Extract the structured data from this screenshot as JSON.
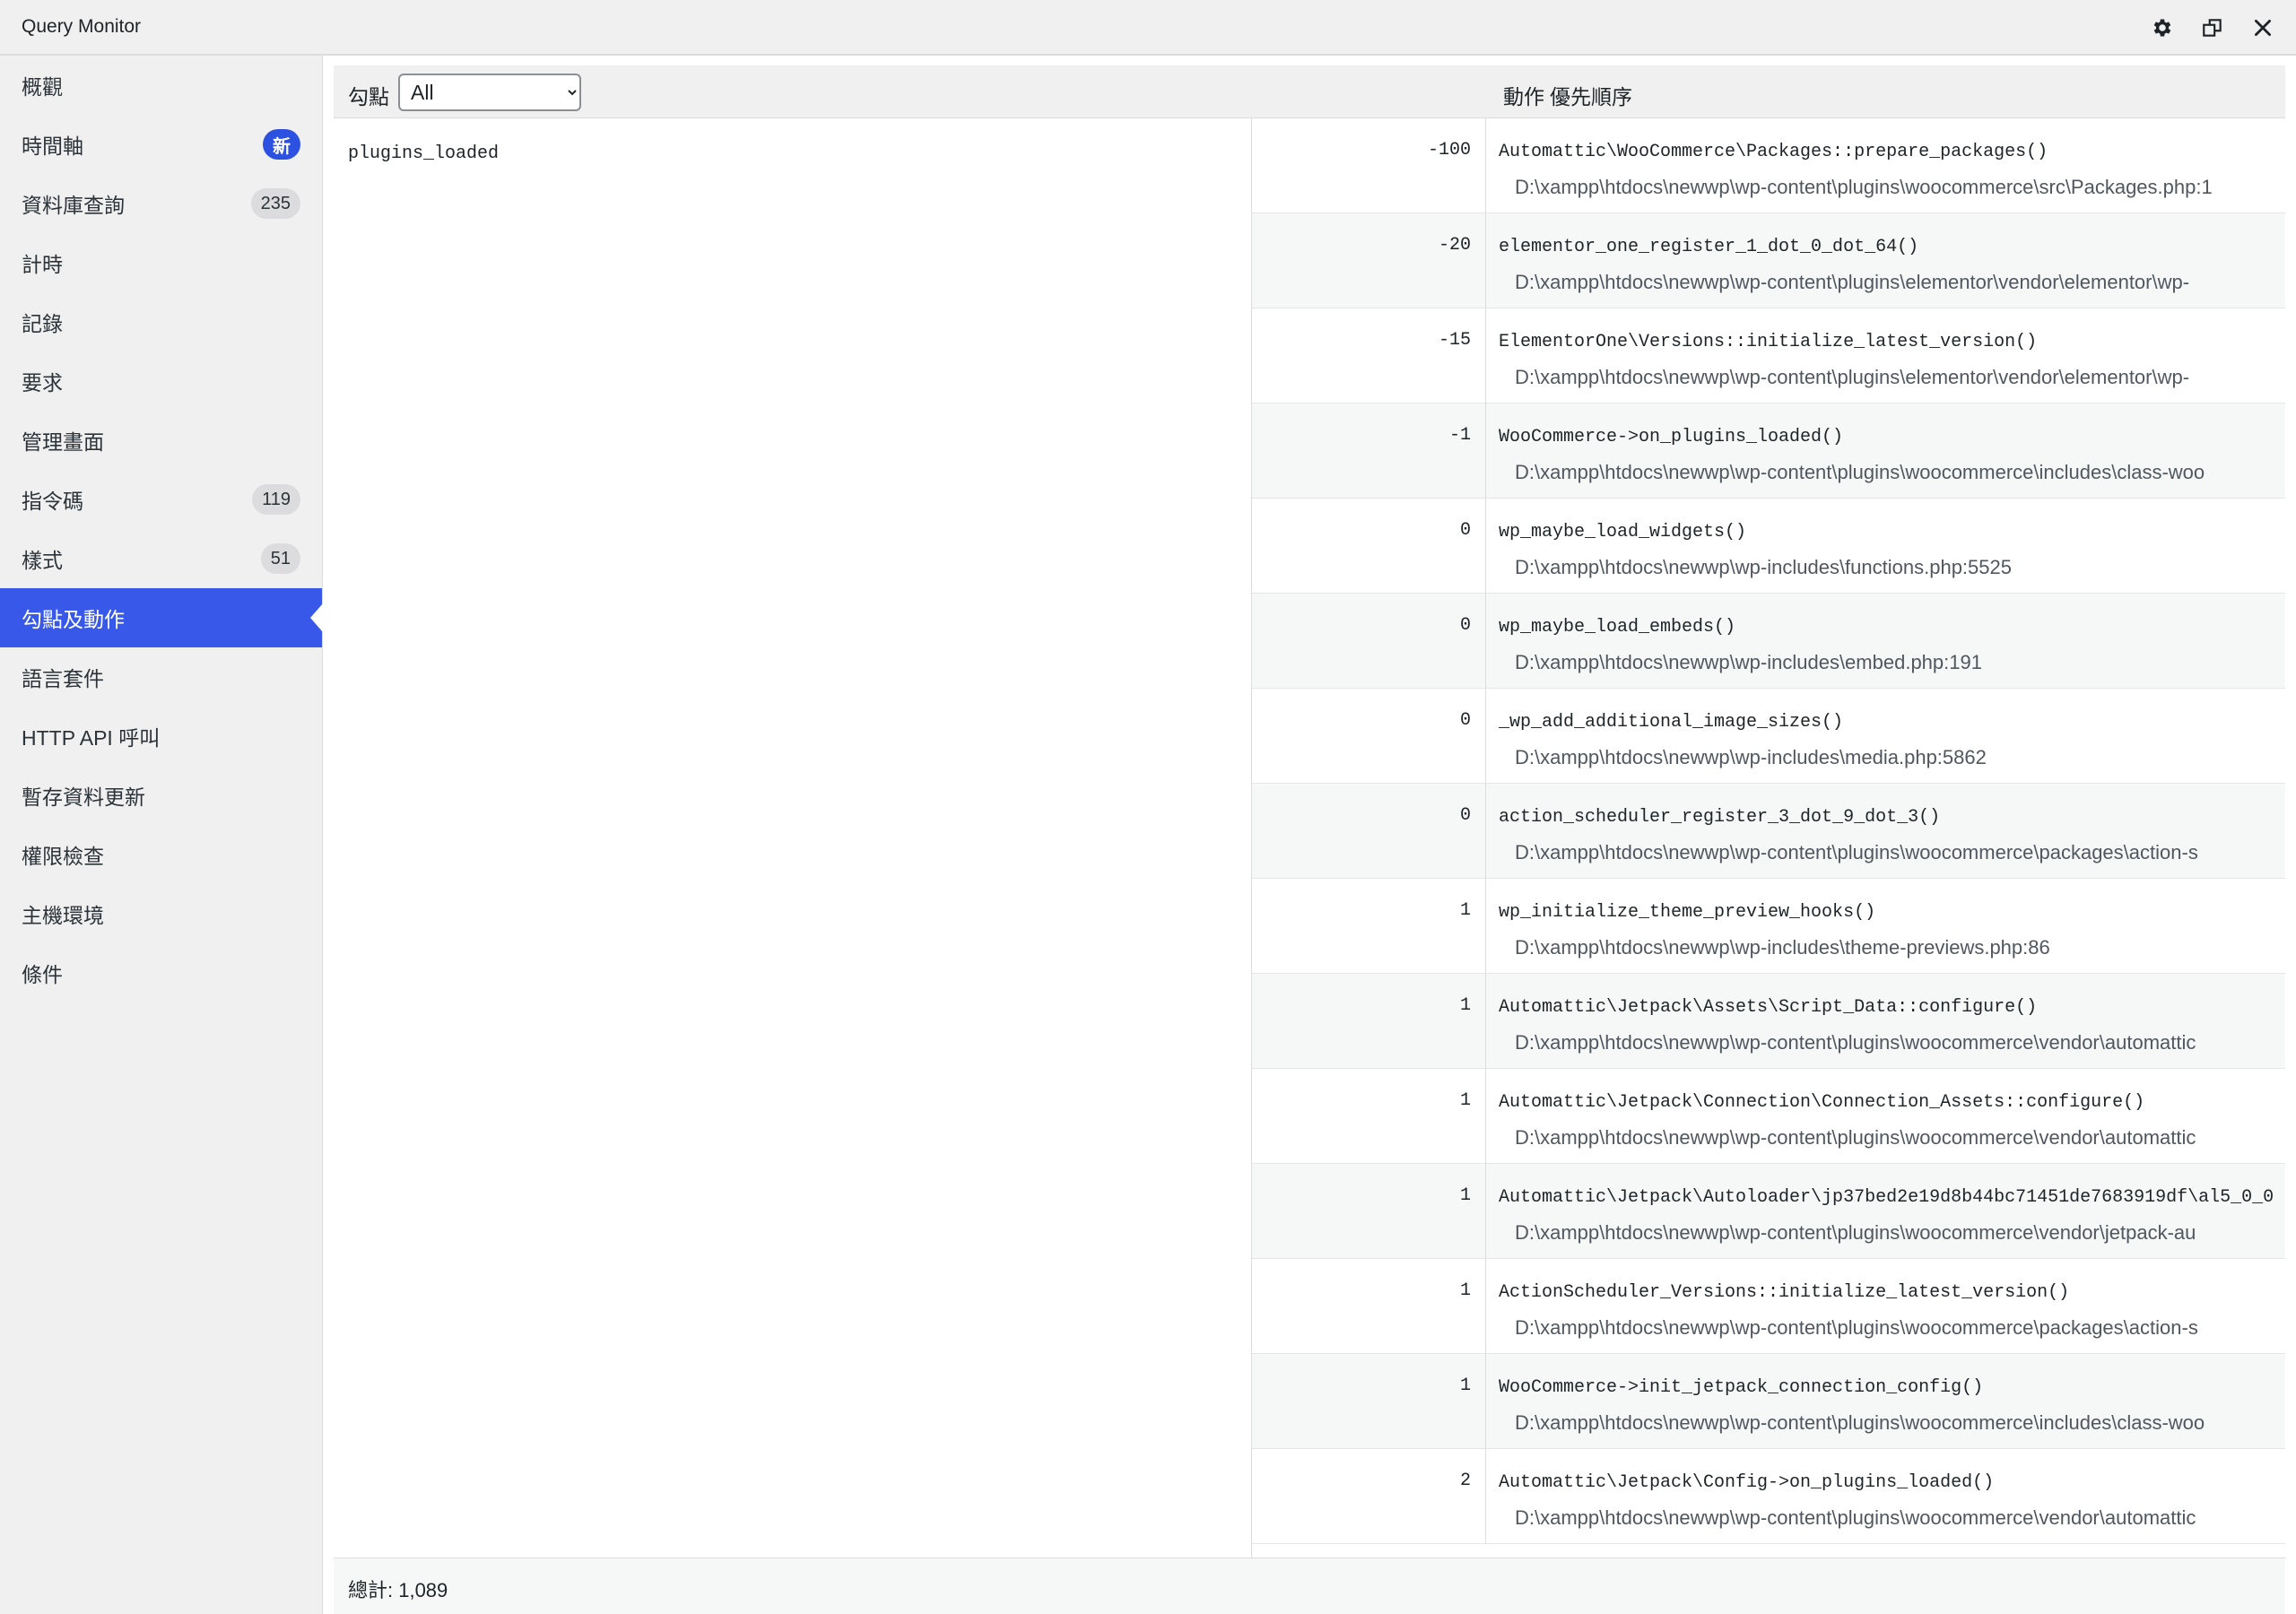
{
  "window": {
    "title": "Query Monitor"
  },
  "title_icons": [
    "gear-icon",
    "popout-icon",
    "close-icon"
  ],
  "sidebar": {
    "items": [
      {
        "label": "概觀",
        "badge": ""
      },
      {
        "label": "時間軸",
        "badge": "新"
      },
      {
        "label": "資料庫查詢",
        "badge": "235"
      },
      {
        "label": "計時",
        "badge": ""
      },
      {
        "label": "記錄",
        "badge": ""
      },
      {
        "label": "要求",
        "badge": ""
      },
      {
        "label": "管理畫面",
        "badge": ""
      },
      {
        "label": "指令碼",
        "badge": "119"
      },
      {
        "label": "樣式",
        "badge": "51"
      },
      {
        "label": "勾點及動作",
        "badge": "",
        "active": true
      },
      {
        "label": "語言套件",
        "badge": ""
      },
      {
        "label": "HTTP API 呼叫",
        "badge": ""
      },
      {
        "label": "暫存資料更新",
        "badge": ""
      },
      {
        "label": "權限檢查",
        "badge": ""
      },
      {
        "label": "主機環境",
        "badge": ""
      },
      {
        "label": "條件",
        "badge": ""
      }
    ]
  },
  "table": {
    "hook_header": "勾點",
    "filter_value": "All",
    "priority_header": "優先順序",
    "action_header": "動作",
    "hook": "plugins_loaded",
    "rows": [
      {
        "priority": "-100",
        "function": "Automattic\\WooCommerce\\Packages::prepare_packages()",
        "file": "D:\\xampp\\htdocs\\newwp\\wp-content\\plugins\\woocommerce\\src\\Packages.php:1"
      },
      {
        "priority": "-20",
        "function": "elementor_one_register_1_dot_0_dot_64()",
        "file": "D:\\xampp\\htdocs\\newwp\\wp-content\\plugins\\elementor\\vendor\\elementor\\wp-"
      },
      {
        "priority": "-15",
        "function": "ElementorOne\\Versions::initialize_latest_version()",
        "file": "D:\\xampp\\htdocs\\newwp\\wp-content\\plugins\\elementor\\vendor\\elementor\\wp-"
      },
      {
        "priority": "-1",
        "function": "WooCommerce->on_plugins_loaded()",
        "file": "D:\\xampp\\htdocs\\newwp\\wp-content\\plugins\\woocommerce\\includes\\class-woo"
      },
      {
        "priority": "0",
        "function": "wp_maybe_load_widgets()",
        "file": "D:\\xampp\\htdocs\\newwp\\wp-includes\\functions.php:5525"
      },
      {
        "priority": "0",
        "function": "wp_maybe_load_embeds()",
        "file": "D:\\xampp\\htdocs\\newwp\\wp-includes\\embed.php:191"
      },
      {
        "priority": "0",
        "function": "_wp_add_additional_image_sizes()",
        "file": "D:\\xampp\\htdocs\\newwp\\wp-includes\\media.php:5862"
      },
      {
        "priority": "0",
        "function": "action_scheduler_register_3_dot_9_dot_3()",
        "file": "D:\\xampp\\htdocs\\newwp\\wp-content\\plugins\\woocommerce\\packages\\action-s"
      },
      {
        "priority": "1",
        "function": "wp_initialize_theme_preview_hooks()",
        "file": "D:\\xampp\\htdocs\\newwp\\wp-includes\\theme-previews.php:86"
      },
      {
        "priority": "1",
        "function": "Automattic\\Jetpack\\Assets\\Script_Data::configure()",
        "file": "D:\\xampp\\htdocs\\newwp\\wp-content\\plugins\\woocommerce\\vendor\\automattic"
      },
      {
        "priority": "1",
        "function": "Automattic\\Jetpack\\Connection\\Connection_Assets::configure()",
        "file": "D:\\xampp\\htdocs\\newwp\\wp-content\\plugins\\woocommerce\\vendor\\automattic"
      },
      {
        "priority": "1",
        "function": "Automattic\\Jetpack\\Autoloader\\jp37bed2e19d8b44bc71451de7683919df\\al5_0_0",
        "file": "D:\\xampp\\htdocs\\newwp\\wp-content\\plugins\\woocommerce\\vendor\\jetpack-au"
      },
      {
        "priority": "1",
        "function": "ActionScheduler_Versions::initialize_latest_version()",
        "file": "D:\\xampp\\htdocs\\newwp\\wp-content\\plugins\\woocommerce\\packages\\action-s"
      },
      {
        "priority": "1",
        "function": "WooCommerce->init_jetpack_connection_config()",
        "file": "D:\\xampp\\htdocs\\newwp\\wp-content\\plugins\\woocommerce\\includes\\class-woo"
      },
      {
        "priority": "2",
        "function": "Automattic\\Jetpack\\Config->on_plugins_loaded()",
        "file": "D:\\xampp\\htdocs\\newwp\\wp-content\\plugins\\woocommerce\\vendor\\automattic"
      }
    ],
    "total": "總計: 1,089"
  }
}
